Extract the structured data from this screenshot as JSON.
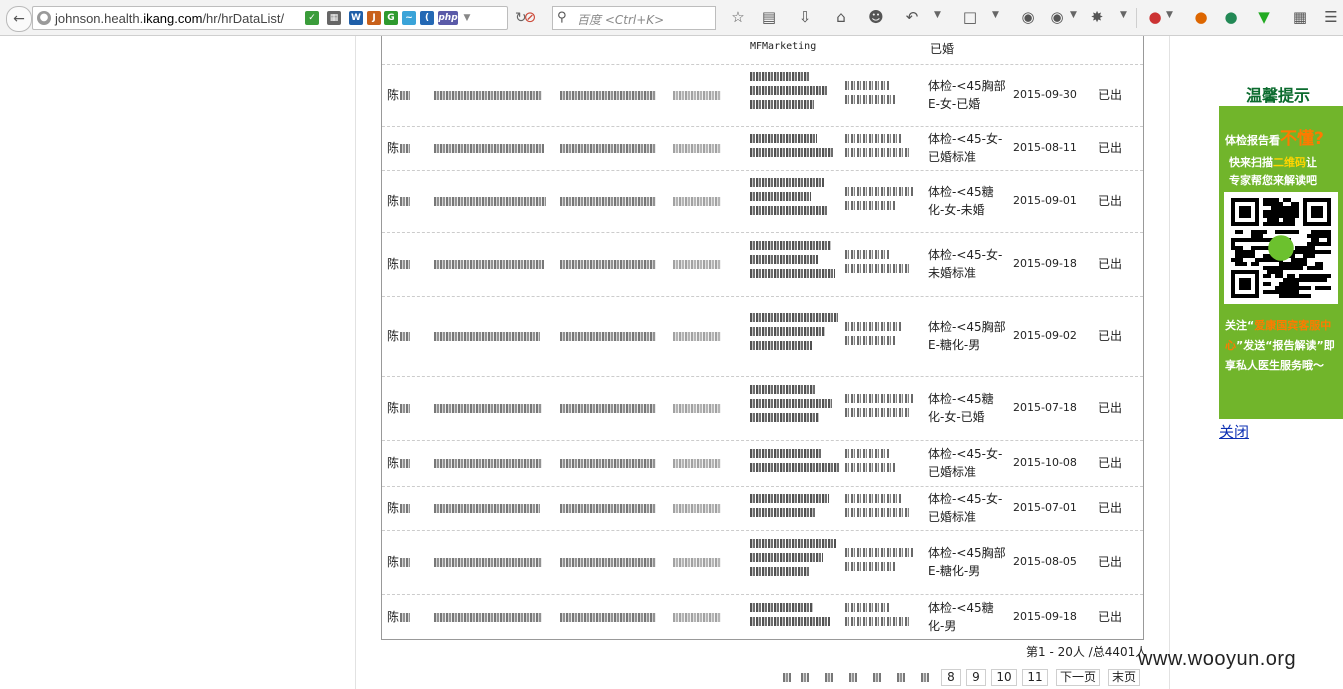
{
  "browser": {
    "url_prefix": "johnson.health.",
    "url_domain": "ikang.com",
    "url_path": "/hr/hrDataList/",
    "search_placeholder": "百度 <Ctrl+K>"
  },
  "table": {
    "top_row": {
      "dept": "MFMarketing",
      "type": "已婚"
    },
    "rows": [
      {
        "name": "陈",
        "dept": "",
        "type": "体检-<45胸部E-女-已婚",
        "date": "2015-09-30",
        "status": "已出"
      },
      {
        "name": "陈",
        "dept": "",
        "type": "体检-<45-女-已婚标准",
        "date": "2015-08-11",
        "status": "已出"
      },
      {
        "name": "陈",
        "dept": "",
        "type": "体检-<45糖化-女-未婚",
        "date": "2015-09-01",
        "status": "已出"
      },
      {
        "name": "陈",
        "dept": "",
        "type": "体检-<45-女-未婚标准",
        "date": "2015-09-18",
        "status": "已出"
      },
      {
        "name": "陈",
        "dept": "",
        "type": "体检-<45胸部E-糖化-男",
        "date": "2015-09-02",
        "status": "已出"
      },
      {
        "name": "陈",
        "dept": "",
        "type": "体检-<45糖化-女-已婚",
        "date": "2015-07-18",
        "status": "已出"
      },
      {
        "name": "陈",
        "dept": "",
        "type": "体检-<45-女-已婚标准",
        "date": "2015-10-08",
        "status": "已出"
      },
      {
        "name": "陈",
        "dept": "",
        "type": "体检-<45-女-已婚标准",
        "date": "2015-07-01",
        "status": "已出"
      },
      {
        "name": "陈",
        "dept": "",
        "type": "体检-<45胸部E-糖化-男",
        "date": "2015-08-05",
        "status": "已出"
      },
      {
        "name": "陈",
        "dept": "",
        "type": "体检-<45糖化-男",
        "date": "2015-09-18",
        "status": "已出"
      }
    ]
  },
  "summary": "第1 - 20人 /总4401人",
  "pager": {
    "pages": [
      "8",
      "9",
      "10",
      "11"
    ],
    "next": "下一页",
    "last": "末页"
  },
  "promo": {
    "title": "温馨提示",
    "line1_a": "体检报告看",
    "line1_b": "不懂?",
    "line2_a": "快来扫描",
    "line2_hl": "二维码",
    "line2_b": "让",
    "line3": "专家帮您来解读吧",
    "line4_a": "关注“",
    "line4_hl": "爱康国宾客服中心",
    "line4_b": "”发送“报告解读”即享私人医生服务哦～",
    "close": "关闭"
  },
  "watermark": "www.wooyun.org"
}
